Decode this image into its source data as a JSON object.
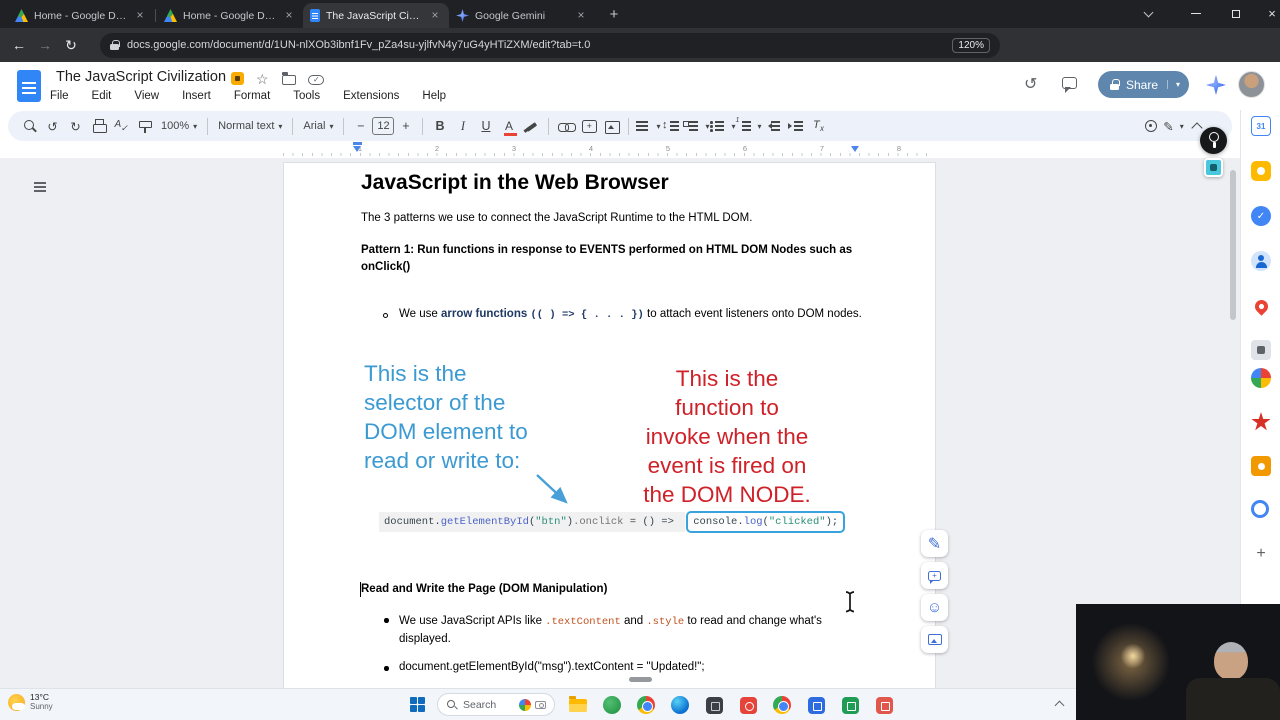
{
  "browser": {
    "tabs": [
      {
        "title": "Home - Google Drive"
      },
      {
        "title": "Home - Google Drive"
      },
      {
        "title": "The JavaScript Civilization - Go"
      },
      {
        "title": "Google Gemini"
      }
    ],
    "url": "docs.google.com/document/d/1UN-nlXOb3ibnf1Fv_pZa4su-yjlfvN4y7uG4yHTiZXM/edit?tab=t.0",
    "zoom_badge": "120%"
  },
  "header": {
    "doc_title": "The JavaScript Civilization",
    "menus": [
      "File",
      "Edit",
      "View",
      "Insert",
      "Format",
      "Tools",
      "Extensions",
      "Help"
    ],
    "share_label": "Share"
  },
  "toolbar": {
    "zoom": "100%",
    "paragraph_style": "Normal text",
    "font": "Arial",
    "font_size": "12",
    "bold": "B",
    "italic": "I",
    "underline": "U",
    "text_color": "A",
    "decrease": "−",
    "increase": "+"
  },
  "ruler": {
    "numbers": [
      "1",
      "2",
      "3",
      "4",
      "5",
      "6",
      "7",
      "8"
    ]
  },
  "doc": {
    "h1": "JavaScript in the Web Browser",
    "intro": "The 3 patterns we use to connect the JavaScript Runtime to the HTML DOM.",
    "pattern_heading": "Pattern 1: Run functions in response to EVENTS performed on HTML DOM Nodes such as onClick()",
    "bullet1": {
      "pre": "We use ",
      "bold": "arrow functions ",
      "code": "(( ) => { . . . })",
      "post": " to attach event listeners onto DOM nodes."
    },
    "annotation": {
      "blue_lines": [
        "This is the",
        "selector of the",
        "DOM element to",
        "read or write to:"
      ],
      "red_lines": [
        "This is the",
        "function to",
        "invoke when the",
        "event is fired on",
        "the DOM NODE."
      ]
    },
    "code_line": {
      "left": [
        {
          "t": "document."
        },
        {
          "t": "getElementById"
        },
        {
          "t": "("
        },
        {
          "t": "\"btn\""
        },
        {
          "t": ")"
        },
        {
          "t": ".onclick"
        },
        {
          "t": " = () => "
        }
      ],
      "boxed": [
        {
          "t": "console."
        },
        {
          "t": "log"
        },
        {
          "t": "("
        },
        {
          "t": "\"clicked\""
        },
        {
          "t": ");"
        }
      ]
    },
    "h2": "Read and Write the Page (DOM Manipulation)",
    "bullet2": {
      "pre": "We use JavaScript APIs like ",
      "code1": ".textContent",
      "mid": " and ",
      "code2": ".style",
      "post": " to read and change what's displayed."
    },
    "bullet3": "document.getElementById(\"msg\").textContent = \"Updated!\";"
  },
  "side_panel": {
    "calendar_day": "31",
    "icons": [
      "calendar",
      "keep",
      "tasks",
      "contacts",
      "maps",
      "extension-1",
      "extension-2",
      "extension-3",
      "extension-4",
      "extension-5",
      "get-add-ons"
    ]
  },
  "taskbar": {
    "weather_temp": "13°C",
    "weather_cond": "Sunny",
    "search_label": "Search",
    "apps": [
      "file-explorer",
      "app-green",
      "chrome",
      "app-blue",
      "app-dark",
      "app-red",
      "chrome-2",
      "app-blue-square",
      "app-green-square",
      "app-red-square"
    ]
  },
  "colors": {
    "docs_blue": "#3086f6",
    "annotation_blue": "#3b9ad1",
    "annotation_red": "#cf2128",
    "code_box_border": "#38a3dc",
    "share_button": "#5f87ad",
    "toolbar_bg": "#edf2fa"
  }
}
